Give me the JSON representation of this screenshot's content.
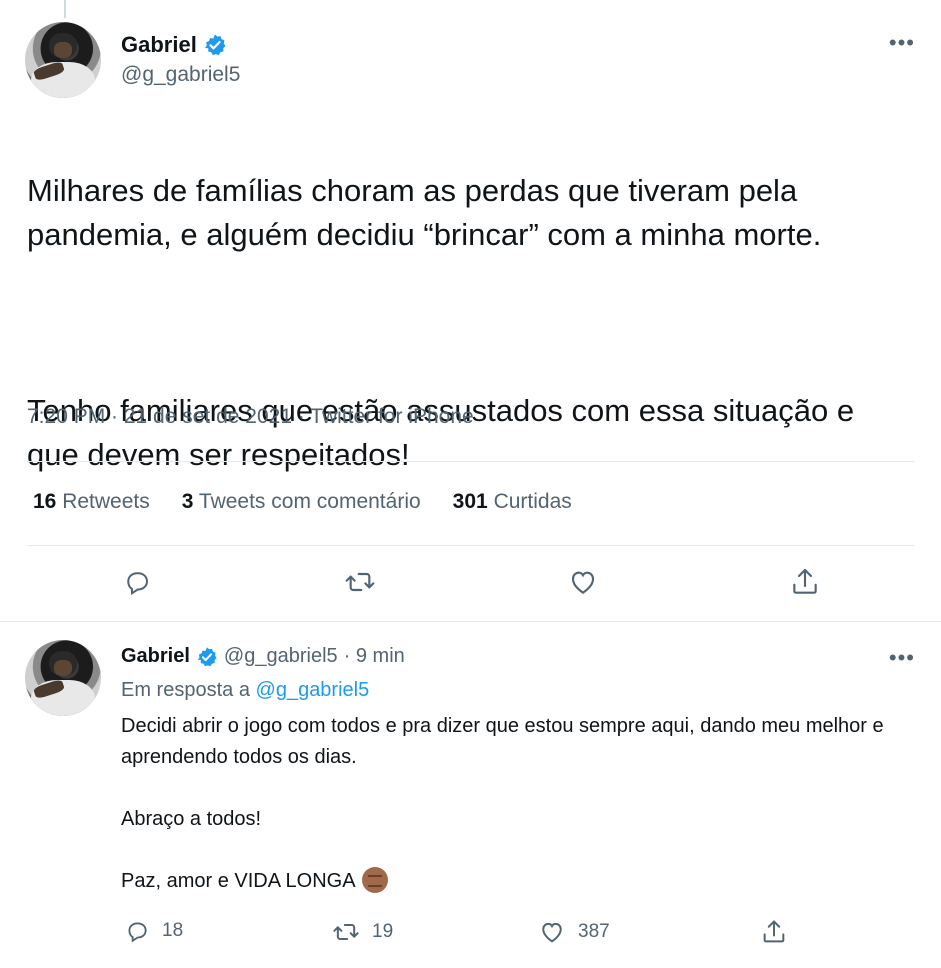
{
  "main_tweet": {
    "author_name": "Gabriel",
    "author_handle": "@g_gabriel5",
    "text_p1": "Milhares de famílias choram as perdas que tiveram pela pandemia, e alguém decidiu “brincar” com a minha morte.",
    "text_p2": "Tenho familiares que estão assustados com essa situação e que devem ser respeitados!",
    "timestamp": "7:20 PM · 21 de set de 2021 · Twitter for iPhone",
    "stats": {
      "retweets_count": "16",
      "retweets_label": "Retweets",
      "quotes_count": "3",
      "quotes_label": "Tweets com comentário",
      "likes_count": "301",
      "likes_label": "Curtidas"
    },
    "actions": [
      "reply-icon",
      "retweet-icon",
      "like-icon",
      "share-icon"
    ]
  },
  "reply_tweet": {
    "author_name": "Gabriel",
    "author_handle": "@g_gabriel5",
    "time_ago": "· 9 min",
    "in_reply_prefix": "Em resposta a",
    "in_reply_handle": "@g_gabriel5",
    "text_p1": "Decidi abrir o jogo com todos e pra dizer que estou sempre aqui, dando meu melhor e aprendendo todos os dias.",
    "text_p2": "Abraço a todos!",
    "text_p3": "Paz, amor e VIDA LONGA",
    "reply_count": "18",
    "retweet_count": "19",
    "like_count": "387"
  },
  "colors": {
    "text_primary": "#0f1419",
    "text_secondary": "#536471",
    "accent": "#1d9bf0",
    "divider": "#e7e9ea"
  }
}
